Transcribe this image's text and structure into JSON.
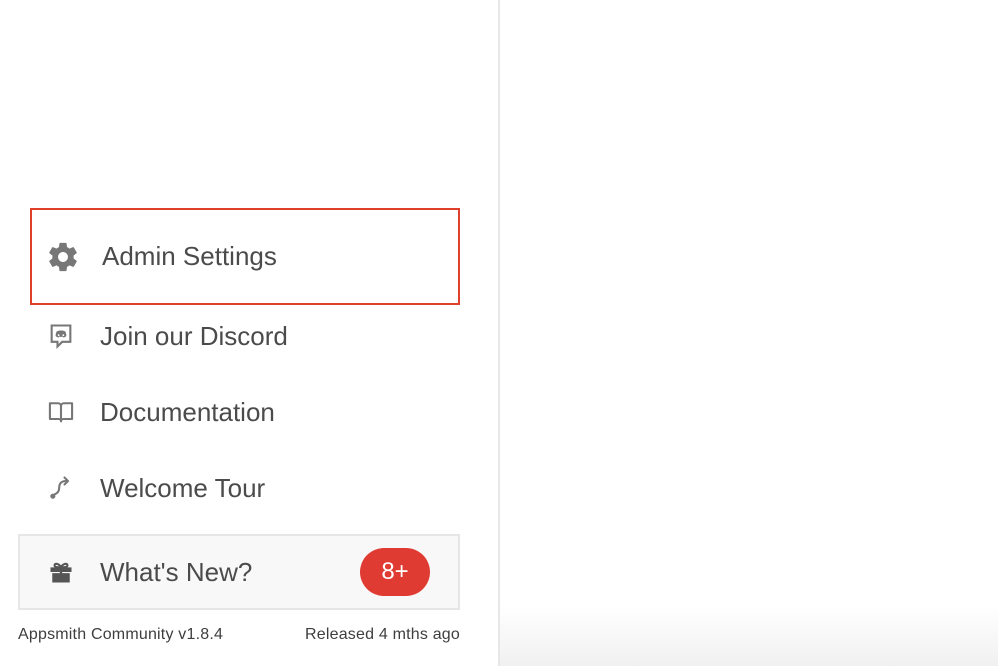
{
  "menu": {
    "items": [
      {
        "label": "Admin Settings",
        "icon": "gear-icon"
      },
      {
        "label": "Join our Discord",
        "icon": "discord-icon"
      },
      {
        "label": "Documentation",
        "icon": "book-icon"
      },
      {
        "label": "Welcome Tour",
        "icon": "route-icon"
      }
    ]
  },
  "whats_new": {
    "label": "What's New?",
    "badge": "8+",
    "icon": "gift-icon"
  },
  "footer": {
    "version": "Appsmith Community v1.8.4",
    "released": "Released 4 mths ago"
  },
  "colors": {
    "highlight_border": "#e0402b",
    "badge_bg": "#df3b32",
    "icon_gray": "#777777",
    "text": "#4b4b4b"
  }
}
